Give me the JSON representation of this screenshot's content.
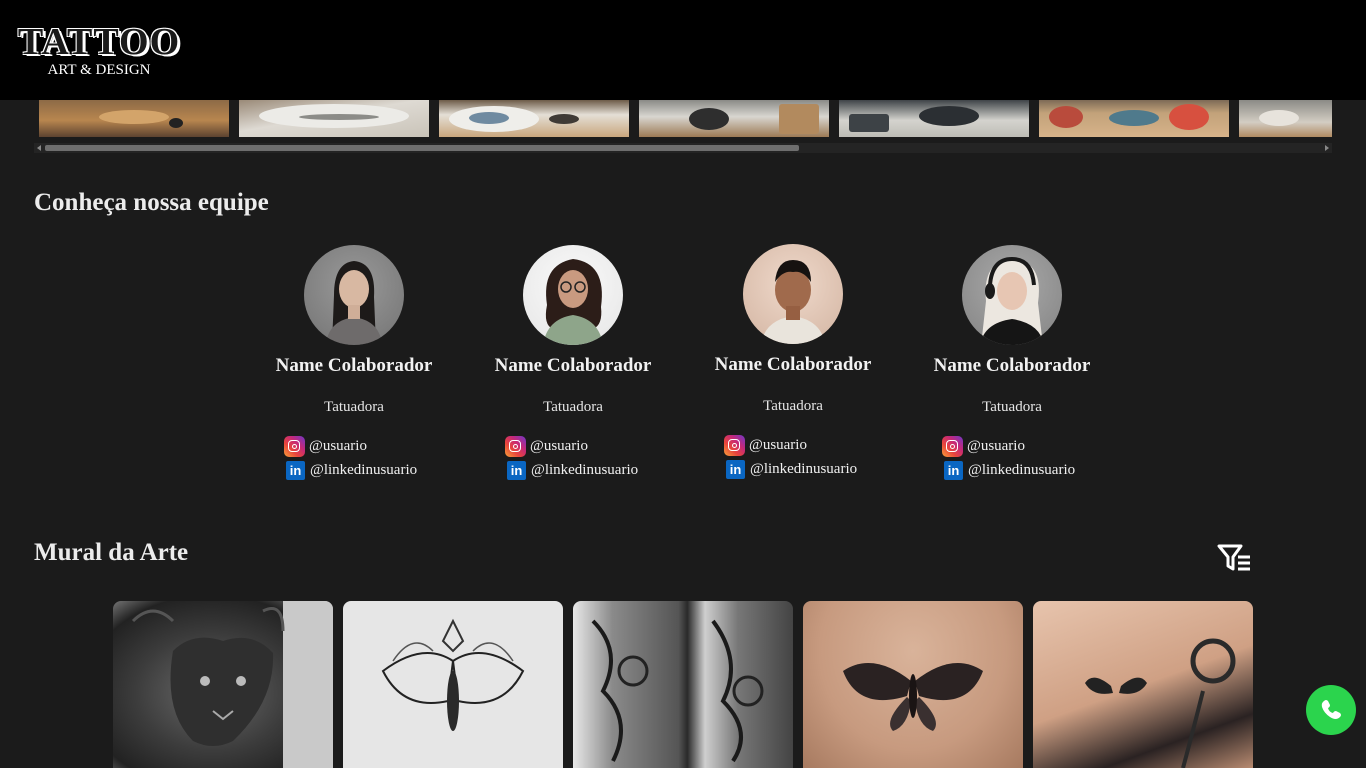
{
  "header": {
    "logo_title": "TATTOO",
    "logo_subtitle": "ART & DESIGN"
  },
  "gallery": {
    "images": [
      "studio-desk",
      "sketch-paper",
      "drawing-table",
      "studio-chair",
      "studio-office",
      "tattoo-flash-table",
      "studio-room"
    ]
  },
  "team": {
    "title": "Conheça nossa equipe",
    "members": [
      {
        "name": "Name Colaborador",
        "role": "Tatuadora",
        "instagram": "@usuario",
        "linkedin": "@linkedinusuario"
      },
      {
        "name": "Name Colaborador",
        "role": "Tatuadora",
        "instagram": "@usuario",
        "linkedin": "@linkedinusuario"
      },
      {
        "name": "Name Colaborador",
        "role": "Tatuadora",
        "instagram": "@usuario",
        "linkedin": "@linkedinusuario"
      },
      {
        "name": "Name Colaborador",
        "role": "Tatuadora",
        "instagram": "@usuario",
        "linkedin": "@linkedinusuario"
      }
    ]
  },
  "mural": {
    "title": "Mural da Arte",
    "filter_icon": "filter-list-icon",
    "artworks": [
      "panther-tattoo",
      "butterfly-sketch",
      "ornamental-sleeve",
      "butterfly-back-tattoo",
      "butterfly-rose-shoulder-tattoo"
    ]
  },
  "whatsapp": {
    "icon": "whatsapp-icon"
  },
  "colors": {
    "background": "#1b1b1b",
    "header": "#000000",
    "whatsapp": "#2bd44d",
    "linkedin": "#0a66c2"
  }
}
